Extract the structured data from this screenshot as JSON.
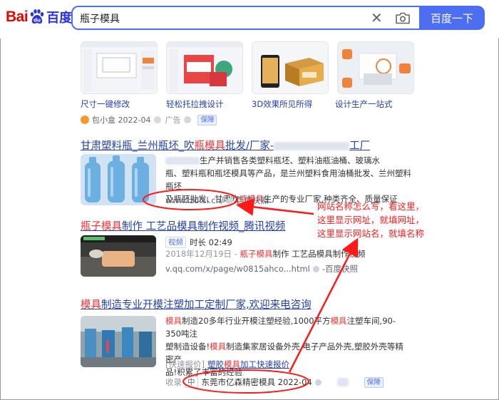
{
  "search": {
    "logo_bai": "Bai",
    "logo_du": "du",
    "logo_cn": "百度",
    "query": "瓶子模具",
    "clear": "✕",
    "button": "百度一下"
  },
  "ads": {
    "captions": [
      "尺寸一键修改",
      "轻松托拉拽设计",
      "3D效果所见所得",
      "设计生产一站式"
    ],
    "meta_brand": "包小盒 2022-04",
    "meta_ad": "广告",
    "meta_bao": "保障"
  },
  "result1": {
    "title_a": "甘肃塑料瓶_兰州瓶坯_吹",
    "title_hl": "瓶模具",
    "title_b": "批发/厂家-",
    "title_c": "工厂",
    "text_1": "生产并销售各类塑料瓶坯、塑料油瓶油桶、玻璃水",
    "text_2": "瓶、塑料瓶和瓶坯模具等产品，是兰州塑料食用油桶批发、兰州塑料瓶坯",
    "text_3a": "及瓶胚批发、甘肃吹",
    "text_3hl": "瓶模具",
    "text_3b": "生产的专业厂家,种类齐全、质量保证",
    "url": "www.lzdfsl.cn/",
    "snapshot": "百度快照"
  },
  "result2": {
    "title_hl": "瓶子模具",
    "title_rest": "制作 工艺品模具制作视频_腾讯视频",
    "tag": "视频",
    "duration": "时长 02:49",
    "date": "2018年12月19日",
    "desc_hl": "瓶子模具",
    "desc_rest": "制作 工艺品模具制作视频",
    "url": "v.qq.com/x/page/w0815ahco...html",
    "snapshot": "百度快照"
  },
  "result3": {
    "title_hl": "模具",
    "title_rest": "制造专业开模注塑加工定制厂家,欢迎来电咨询",
    "l1_hl": "模具",
    "l1_a": "制造20多年行业开模注塑经验,1000平方",
    "l1_hl2": "模具",
    "l1_b": "注塑车间,90-350吨注",
    "l2_a": "塑制造设备!",
    "l2_hl": "模具",
    "l2_b": "制造集家居设备外壳,电子产品外壳,塑胶外壳等精密产",
    "l3": "品!积累了丰富的经验",
    "quick_tag": "[快速报价]",
    "quick_a": "塑胶",
    "quick_hl": "模具",
    "quick_b": "加工快速报价",
    "src_tag": "收录",
    "src_zhong": "中",
    "src_name": "东莞市亿森精密模具 2022-04",
    "bao": "保障"
  },
  "annotation": {
    "line1": "网站名称怎么写，看这里，",
    "line2": "这里显示网址，就填网址，",
    "line3": "这里显示网站名，就填名称",
    "color": "#ff1a1a"
  }
}
